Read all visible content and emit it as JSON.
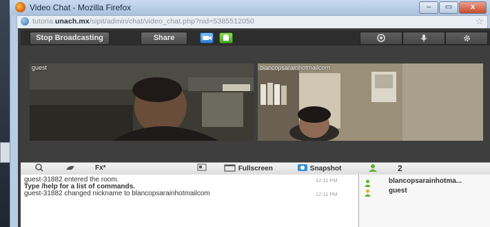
{
  "browser": {
    "title": "Video Chat - Mozilla Firefox",
    "url_prefix": "tutoria.",
    "url_domain": "unach.mx",
    "url_path": "/sipit/admin/chat/video_chat.php?nid=5385512050",
    "win_buttons": [
      "–",
      "▭",
      "x"
    ]
  },
  "toolbar": {
    "stop_label": "Stop Broadcasting",
    "share_label": "Share"
  },
  "videos": {
    "left_name": "guest",
    "right_name": "blancopsarainhotmailcom"
  },
  "controls": {
    "fx_label": "Fx*",
    "fullscreen_label": "Fullscreen",
    "snapshot_label": "Snapshot",
    "user_count": "2"
  },
  "chat": {
    "messages": [
      {
        "text": "guest-31882 entered the room.",
        "time": "12:11 PM",
        "bold": false
      },
      {
        "text": "Type /help for a list of commands.",
        "time": "",
        "bold": true
      },
      {
        "text": "guest-31882 changed nickname to blancopsarainhotmailcom",
        "time": "12:11 PM",
        "bold": false
      }
    ]
  },
  "users": [
    "blancopsarainhotma...",
    "guest"
  ],
  "colors": {
    "accent_green": "#5ab52e",
    "camera_blue": "#3a8fd8"
  }
}
